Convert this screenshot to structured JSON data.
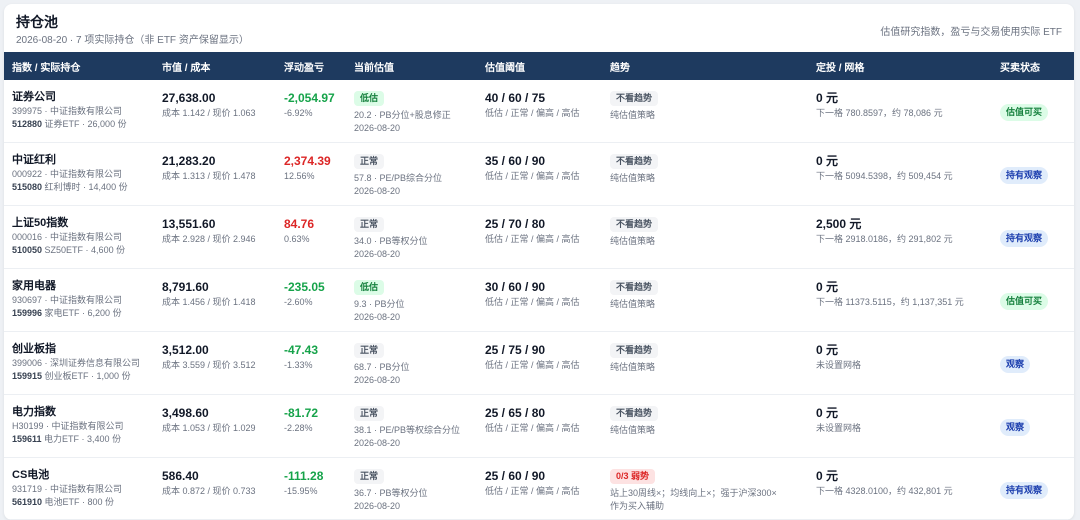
{
  "header": {
    "title": "持仓池",
    "subtitle": "2026-08-20 · 7 项实际持仓（非 ETF 资产保留显示）",
    "note": "估值研究指数，盈亏与交易使用实际 ETF"
  },
  "columns": [
    "指数 / 实际持仓",
    "市值 / 成本",
    "浮动盈亏",
    "当前估值",
    "估值阈值",
    "趋势",
    "定投 / 网格",
    "买卖状态"
  ],
  "colors": {
    "header_bg": "#1e3a5f",
    "gain": "#dc2626",
    "loss": "#16a34a",
    "low_tag": "#15803d",
    "watch_tag": "#1e40af"
  },
  "rows": [
    {
      "name": "证券公司",
      "index_code": "399975 · 中证指数有限公司",
      "etf_code": "512880",
      "etf_rest": " 证券ETF · 26,000 份",
      "market_value": "27,638.00",
      "cost": "成本 1.142 / 现价 1.063",
      "pnl": "-2,054.97",
      "pnl_pct": "-6.92%",
      "pnl_dir": "neg",
      "val_tag": "低估",
      "val_tag_kind": "low",
      "val_detail": "20.2 · PB分位+股息修正",
      "val_date": "2026-08-20",
      "threshold": "40 / 60 / 75",
      "threshold_legend": "低估 / 正常 / 偏高 / 高估",
      "trend_tag": "不看趋势",
      "trend_tag_kind": "trend",
      "trend_detail": "纯估值策略",
      "invest": "0 元",
      "grid": "下一格 780.8597，约 78,086 元",
      "status": "估值可买",
      "status_kind": "green"
    },
    {
      "name": "中证红利",
      "index_code": "000922 · 中证指数有限公司",
      "etf_code": "515080",
      "etf_rest": " 红利博时 · 14,400 份",
      "market_value": "21,283.20",
      "cost": "成本 1.313 / 现价 1.478",
      "pnl": "2,374.39",
      "pnl_pct": "12.56%",
      "pnl_dir": "pos",
      "val_tag": "正常",
      "val_tag_kind": "normal",
      "val_detail": "57.8 · PE/PB综合分位",
      "val_date": "2026-08-20",
      "threshold": "35 / 60 / 90",
      "threshold_legend": "低估 / 正常 / 偏高 / 高估",
      "trend_tag": "不看趋势",
      "trend_tag_kind": "trend",
      "trend_detail": "纯估值策略",
      "invest": "0 元",
      "grid": "下一格 5094.5398，约 509,454 元",
      "status": "持有观察",
      "status_kind": "blue"
    },
    {
      "name": "上证50指数",
      "index_code": "000016 · 中证指数有限公司",
      "etf_code": "510050",
      "etf_rest": " SZ50ETF · 4,600 份",
      "market_value": "13,551.60",
      "cost": "成本 2.928 / 现价 2.946",
      "pnl": "84.76",
      "pnl_pct": "0.63%",
      "pnl_dir": "pos",
      "val_tag": "正常",
      "val_tag_kind": "normal",
      "val_detail": "34.0 · PB等权分位",
      "val_date": "2026-08-20",
      "threshold": "25 / 70 / 80",
      "threshold_legend": "低估 / 正常 / 偏高 / 高估",
      "trend_tag": "不看趋势",
      "trend_tag_kind": "trend",
      "trend_detail": "纯估值策略",
      "invest": "2,500 元",
      "grid": "下一格 2918.0186，约 291,802 元",
      "status": "持有观察",
      "status_kind": "blue"
    },
    {
      "name": "家用电器",
      "index_code": "930697 · 中证指数有限公司",
      "etf_code": "159996",
      "etf_rest": " 家电ETF · 6,200 份",
      "market_value": "8,791.60",
      "cost": "成本 1.456 / 现价 1.418",
      "pnl": "-235.05",
      "pnl_pct": "-2.60%",
      "pnl_dir": "neg",
      "val_tag": "低估",
      "val_tag_kind": "low",
      "val_detail": "9.3 · PB分位",
      "val_date": "2026-08-20",
      "threshold": "30 / 60 / 90",
      "threshold_legend": "低估 / 正常 / 偏高 / 高估",
      "trend_tag": "不看趋势",
      "trend_tag_kind": "trend",
      "trend_detail": "纯估值策略",
      "invest": "0 元",
      "grid": "下一格 11373.5115，约 1,137,351 元",
      "status": "估值可买",
      "status_kind": "green"
    },
    {
      "name": "创业板指",
      "index_code": "399006 · 深圳证券信息有限公司",
      "etf_code": "159915",
      "etf_rest": " 创业板ETF · 1,000 份",
      "market_value": "3,512.00",
      "cost": "成本 3.559 / 现价 3.512",
      "pnl": "-47.43",
      "pnl_pct": "-1.33%",
      "pnl_dir": "neg",
      "val_tag": "正常",
      "val_tag_kind": "normal",
      "val_detail": "68.7 · PB分位",
      "val_date": "2026-08-20",
      "threshold": "25 / 75 / 90",
      "threshold_legend": "低估 / 正常 / 偏高 / 高估",
      "trend_tag": "不看趋势",
      "trend_tag_kind": "trend",
      "trend_detail": "纯估值策略",
      "invest": "0 元",
      "grid": "未设置网格",
      "status": "观察",
      "status_kind": "blue"
    },
    {
      "name": "电力指数",
      "index_code": "H30199 · 中证指数有限公司",
      "etf_code": "159611",
      "etf_rest": " 电力ETF · 3,400 份",
      "market_value": "3,498.60",
      "cost": "成本 1.053 / 现价 1.029",
      "pnl": "-81.72",
      "pnl_pct": "-2.28%",
      "pnl_dir": "neg",
      "val_tag": "正常",
      "val_tag_kind": "normal",
      "val_detail": "38.1 · PE/PB等权综合分位",
      "val_date": "2026-08-20",
      "threshold": "25 / 65 / 80",
      "threshold_legend": "低估 / 正常 / 偏高 / 高估",
      "trend_tag": "不看趋势",
      "trend_tag_kind": "trend",
      "trend_detail": "纯估值策略",
      "invest": "0 元",
      "grid": "未设置网格",
      "status": "观察",
      "status_kind": "blue"
    },
    {
      "name": "CS电池",
      "index_code": "931719 · 中证指数有限公司",
      "etf_code": "561910",
      "etf_rest": " 电池ETF · 800 份",
      "market_value": "586.40",
      "cost": "成本 0.872 / 现价 0.733",
      "pnl": "-111.28",
      "pnl_pct": "-15.95%",
      "pnl_dir": "neg",
      "val_tag": "正常",
      "val_tag_kind": "normal",
      "val_detail": "36.7 · PB等权分位",
      "val_date": "2026-08-20",
      "threshold": "25 / 60 / 90",
      "threshold_legend": "低估 / 正常 / 偏高 / 高估",
      "trend_tag": "0/3 弱势",
      "trend_tag_kind": "weak",
      "trend_detail": "站上30周线×；均线向上×；强于沪深300×",
      "trend_detail2": "作为买入辅助",
      "invest": "0 元",
      "grid": "下一格 4328.0100，约 432,801 元",
      "status": "持有观察",
      "status_kind": "blue"
    }
  ]
}
